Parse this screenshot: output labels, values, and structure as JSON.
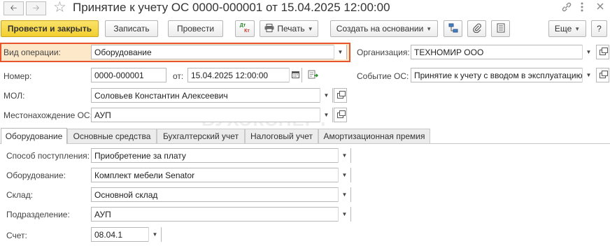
{
  "title": "Принятие к учету ОС 0000-000001 от 15.04.2025 12:00:00",
  "icons": {
    "back": "arrow-left-icon",
    "forward": "arrow-right-icon",
    "favorite": "star-icon",
    "link": "link-icon",
    "more": "more-vertical-icon",
    "close": "close-icon"
  },
  "toolbar": {
    "post_close": "Провести и закрыть",
    "save": "Записать",
    "post": "Провести",
    "dtkt_top": "Дт",
    "dtkt_bottom": "Кт",
    "print": "Печать",
    "create_based": "Создать на основании",
    "more": "Еще",
    "help": "?"
  },
  "form": {
    "operation_label": "Вид операции:",
    "operation_value": "Оборудование",
    "org_label": "Организация:",
    "org_value": "ТЕХНОМИР ООО",
    "number_label": "Номер:",
    "number_value": "0000-000001",
    "from_label": "от:",
    "date_value": "15.04.2025 12:00:00",
    "event_label": "Событие ОС:",
    "event_value": "Принятие к учету с вводом в эксплуатацию",
    "mol_label": "МОЛ:",
    "mol_value": "Соловьев Константин Алексеевич",
    "location_label": "Местонахождение ОС:",
    "location_value": "АУП"
  },
  "watermark": "БУХЭКСПЕРТ",
  "tabs": [
    {
      "label": "Оборудование",
      "active": true
    },
    {
      "label": "Основные средства",
      "active": false
    },
    {
      "label": "Бухгалтерский учет",
      "active": false
    },
    {
      "label": "Налоговый учет",
      "active": false
    },
    {
      "label": "Амортизационная премия",
      "active": false
    }
  ],
  "tab_content": {
    "receipt_label": "Способ поступления:",
    "receipt_value": "Приобретение за плату",
    "equipment_label": "Оборудование:",
    "equipment_value": "Комплект мебели Senator",
    "warehouse_label": "Склад:",
    "warehouse_value": "Основной склад",
    "department_label": "Подразделение:",
    "department_value": "АУП",
    "account_label": "Счет:",
    "account_value": "08.04.1"
  },
  "colors": {
    "primary_button": "#f2cf2f",
    "highlight_border": "#e8542c",
    "highlight_fill": "#fde9c9"
  }
}
